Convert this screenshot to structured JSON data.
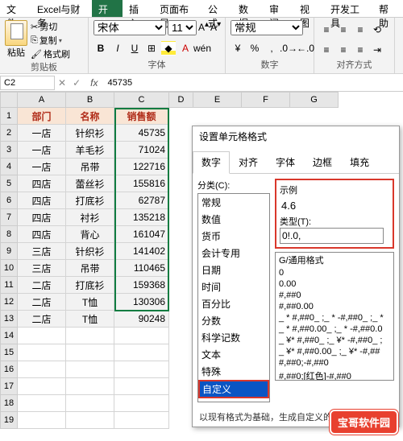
{
  "menubar": [
    "文件",
    "Excel与财务",
    "开始",
    "插入",
    "页面布局",
    "公式",
    "数据",
    "审阅",
    "视图",
    "开发工具",
    "帮助"
  ],
  "menubar_active": 2,
  "ribbon": {
    "clipboard": {
      "paste": "粘贴",
      "cut": "剪切",
      "copy": "复制",
      "brush": "格式刷",
      "label": "剪贴板"
    },
    "font": {
      "name": "宋体",
      "size": "11",
      "label": "字体",
      "bold": "B",
      "italic": "I",
      "underline": "U"
    },
    "number": {
      "format": "常规",
      "label": "数字"
    },
    "align": {
      "label": "对齐方式"
    }
  },
  "namebox": "C2",
  "formula": "45735",
  "fx": "fx",
  "columns": [
    "A",
    "B",
    "C",
    "D",
    "E",
    "F",
    "G"
  ],
  "rows_count": 19,
  "headers": {
    "A": "部门",
    "B": "名称",
    "C": "销售额"
  },
  "table": [
    {
      "A": "一店",
      "B": "针织衫",
      "C": "45735"
    },
    {
      "A": "一店",
      "B": "羊毛衫",
      "C": "71024"
    },
    {
      "A": "一店",
      "B": "吊带",
      "C": "122716"
    },
    {
      "A": "四店",
      "B": "蕾丝衫",
      "C": "155816"
    },
    {
      "A": "四店",
      "B": "打底衫",
      "C": "62787"
    },
    {
      "A": "四店",
      "B": "衬衫",
      "C": "135218"
    },
    {
      "A": "四店",
      "B": "背心",
      "C": "161047"
    },
    {
      "A": "三店",
      "B": "针织衫",
      "C": "141402"
    },
    {
      "A": "三店",
      "B": "吊带",
      "C": "110465"
    },
    {
      "A": "二店",
      "B": "打底衫",
      "C": "159368"
    },
    {
      "A": "二店",
      "B": "T恤",
      "C": "130306"
    },
    {
      "A": "二店",
      "B": "T恤",
      "C": "90248"
    }
  ],
  "dialog": {
    "title": "设置单元格格式",
    "tabs": [
      "数字",
      "对齐",
      "字体",
      "边框",
      "填充"
    ],
    "active_tab": 0,
    "category_label": "分类(C):",
    "categories": [
      "常规",
      "数值",
      "货币",
      "会计专用",
      "日期",
      "时间",
      "百分比",
      "分数",
      "科学记数",
      "文本",
      "特殊",
      "自定义"
    ],
    "selected_category": 11,
    "sample_label": "示例",
    "sample_value": "4.6",
    "type_label": "类型(T):",
    "type_value": "0!.0,",
    "formats": [
      "G/通用格式",
      "0",
      "0.00",
      "#,##0",
      "#,##0.00",
      "_ * #,##0_ ;_ * -#,##0_ ;_ *",
      "_ * #,##0.00_ ;_ * -#,##0.0",
      "_ ¥* #,##0_ ;_ ¥* -#,##0_ ;",
      "_ ¥* #,##0.00_ ;_ ¥* -#,##",
      "#,##0;-#,##0",
      "#,##0;[红色]-#,##0"
    ],
    "footer": "以现有格式为基础，生成自定义的数字格式"
  },
  "watermark": "宝哥软件园"
}
